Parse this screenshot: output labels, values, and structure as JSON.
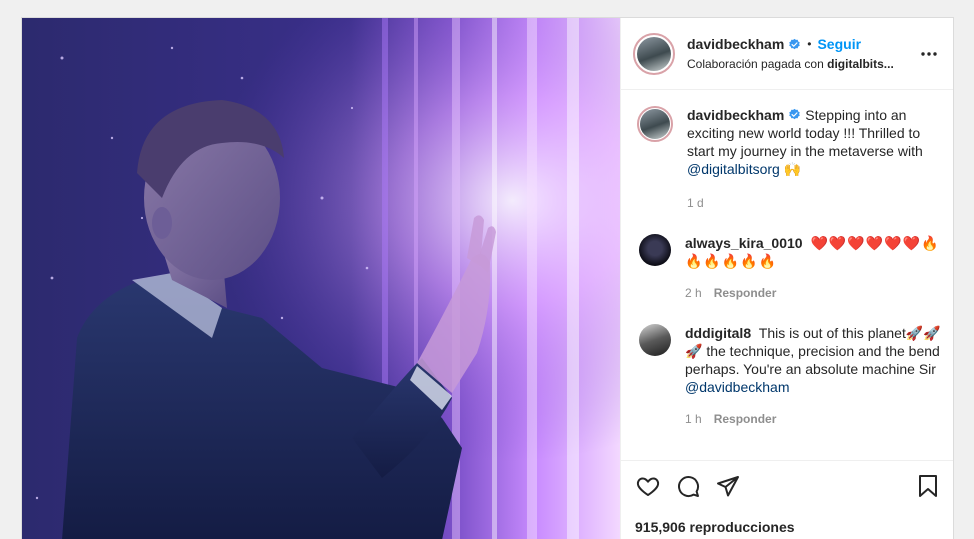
{
  "post": {
    "author": "davidbeckham",
    "follow_label": "Seguir",
    "separator": "•",
    "collab_prefix": "Colaboración pagada con",
    "collab_partner": "digitalbits..."
  },
  "caption": {
    "author": "davidbeckham",
    "text": "Stepping into an exciting new world today !!! Thrilled to start my journey in the metaverse with",
    "mention": "@digitalbitsorg",
    "emoji": "🙌",
    "time": "1 d"
  },
  "comments": [
    {
      "author": "always_kira_0010",
      "text": "❤️❤️❤️❤️❤️❤️🔥🔥🔥🔥🔥🔥",
      "time": "2 h",
      "reply_label": "Responder"
    },
    {
      "author": "dddigital8",
      "text": "This is out of this planet🚀🚀🚀 the technique, precision and the bend perhaps. You're an absolute machine Sir",
      "mention": "@davidbeckham",
      "time": "1 h",
      "reply_label": "Responder"
    }
  ],
  "stats": {
    "views_count": "915,906",
    "views_label": "reproducciones"
  },
  "icons": {
    "verified": "verified-badge-icon",
    "more": "more-options-icon",
    "like": "heart-icon",
    "comment": "comment-icon",
    "share": "send-icon",
    "save": "bookmark-icon"
  },
  "colors": {
    "accent": "#0095f6",
    "verified": "#3897f0",
    "media_base": "#2a2768",
    "media_glow": "#c87cff"
  }
}
